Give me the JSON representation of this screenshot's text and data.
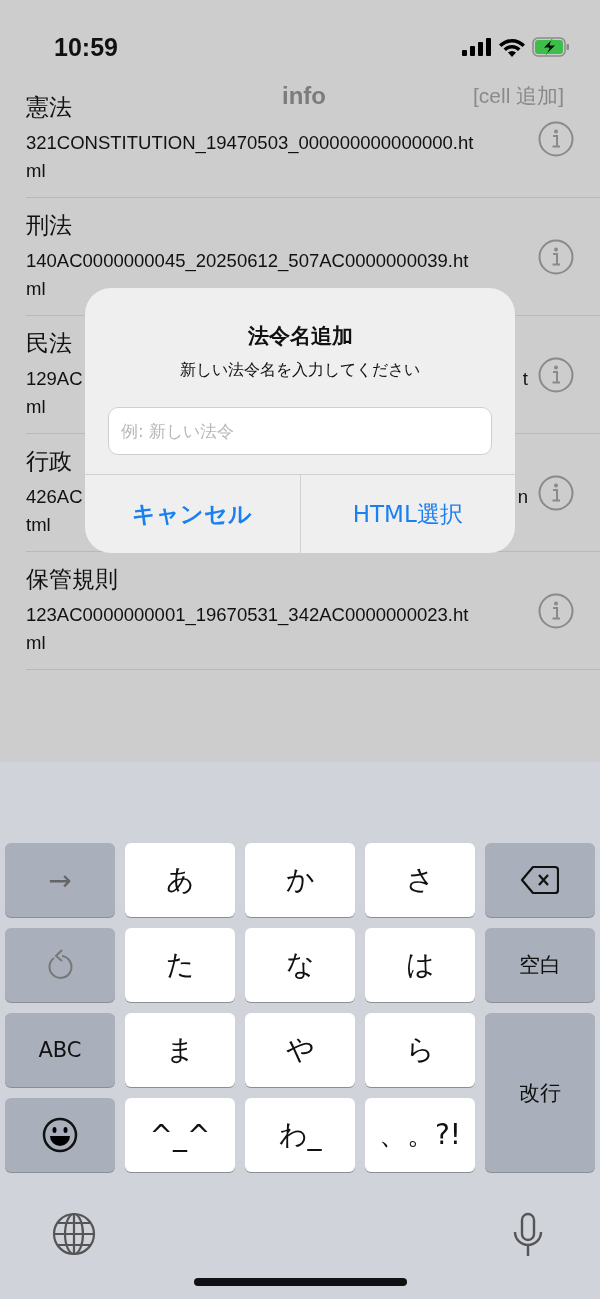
{
  "status_bar": {
    "time": "10:59"
  },
  "nav": {
    "title": "info",
    "action": "[cell 追加]"
  },
  "rows": [
    {
      "kind": "full",
      "title": "憲法",
      "file_lines": [
        "321CONSTITUTION_19470503_000000000000000.ht",
        "ml"
      ]
    },
    {
      "kind": "full",
      "title": "刑法",
      "file_lines": [
        "140AC0000000045_20250612_507AC0000000039.ht",
        "ml"
      ]
    },
    {
      "kind": "covered",
      "title": "民法",
      "file_left": "129AC",
      "file_right": "t",
      "file_tail": "ml"
    },
    {
      "kind": "covered",
      "title": "行政",
      "file_left": "426AC",
      "file_right": "n",
      "file_tail": "tml"
    },
    {
      "kind": "full",
      "title": "保管規則",
      "file_lines": [
        "123AC0000000001_19670531_342AC0000000023.ht",
        "ml"
      ]
    }
  ],
  "alert": {
    "title": "法令名追加",
    "message": "新しい法令名を入力してください",
    "placeholder": "例: 新しい法令",
    "buttons": [
      {
        "label": "キャンセル",
        "kind": "cancel"
      },
      {
        "label": "HTML選択",
        "kind": "default"
      }
    ]
  },
  "keyboard": {
    "keys": [
      {
        "kind": "arrow",
        "label": "→"
      },
      {
        "kind": "kana",
        "label": "あ"
      },
      {
        "kind": "kana",
        "label": "か"
      },
      {
        "kind": "kana",
        "label": "さ"
      },
      {
        "kind": "delete"
      },
      {
        "kind": "undo"
      },
      {
        "kind": "kana",
        "label": "た"
      },
      {
        "kind": "kana",
        "label": "な"
      },
      {
        "kind": "kana",
        "label": "は"
      },
      {
        "kind": "func",
        "label": "空白"
      },
      {
        "kind": "func",
        "label": "ABC"
      },
      {
        "kind": "kana",
        "label": "ま"
      },
      {
        "kind": "kana",
        "label": "や"
      },
      {
        "kind": "kana",
        "label": "ら"
      },
      {
        "kind": "return",
        "label": "改行"
      },
      {
        "kind": "emoji"
      },
      {
        "kind": "kana",
        "label": "^_^"
      },
      {
        "kind": "kana",
        "label": "わ_"
      },
      {
        "kind": "kana",
        "label": "、。?!"
      }
    ]
  }
}
